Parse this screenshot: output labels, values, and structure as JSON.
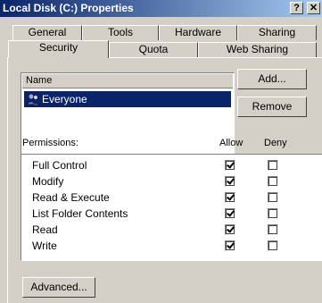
{
  "window": {
    "title": "Local Disk (C:) Properties",
    "help_glyph": "?",
    "close_glyph": "✕"
  },
  "tabs_back": [
    "General",
    "Tools",
    "Hardware",
    "Sharing"
  ],
  "tabs_front": [
    "Security",
    "Quota",
    "Web Sharing"
  ],
  "active_tab": "Security",
  "names": {
    "column_header": "Name",
    "items": [
      {
        "label": "Everyone",
        "icon": "users-group-icon",
        "selected": true
      }
    ]
  },
  "buttons": {
    "add": "Add...",
    "remove": "Remove",
    "advanced": "Advanced..."
  },
  "permissions": {
    "label": "Permissions:",
    "allow_header": "Allow",
    "deny_header": "Deny",
    "rows": [
      {
        "name": "Full Control",
        "allow": true,
        "deny": false
      },
      {
        "name": "Modify",
        "allow": true,
        "deny": false
      },
      {
        "name": "Read & Execute",
        "allow": true,
        "deny": false
      },
      {
        "name": "List Folder Contents",
        "allow": true,
        "deny": false
      },
      {
        "name": "Read",
        "allow": true,
        "deny": false
      },
      {
        "name": "Write",
        "allow": true,
        "deny": false
      }
    ]
  },
  "colors": {
    "titlebar_start": "#0a246a",
    "titlebar_end": "#a6caf0",
    "selection": "#0a246a",
    "face": "#d4d0c8"
  }
}
